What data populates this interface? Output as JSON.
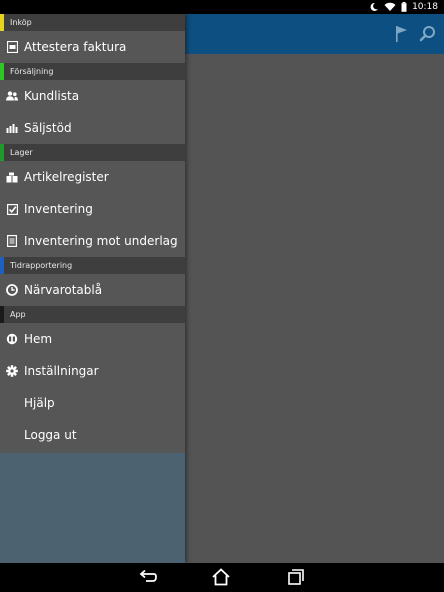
{
  "status": {
    "time": "10:18",
    "icons": [
      "moon-icon",
      "wifi-icon",
      "battery-icon"
    ]
  },
  "toolbar": {
    "icons": [
      "flag-icon",
      "search-icon"
    ]
  },
  "drawer": {
    "sections": [
      {
        "title": "Inköp",
        "accent": "#e7d21d",
        "items": [
          {
            "label": "Attestera faktura",
            "icon": "invoice-icon"
          }
        ]
      },
      {
        "title": "Försäljning",
        "accent": "#2fc626",
        "items": [
          {
            "label": "Kundlista",
            "icon": "people-icon"
          },
          {
            "label": "Säljstöd",
            "icon": "bar-chart-icon"
          }
        ]
      },
      {
        "title": "Lager",
        "accent": "#1f9a2c",
        "items": [
          {
            "label": "Artikelregister",
            "icon": "boxes-icon"
          },
          {
            "label": "Inventering",
            "icon": "checkbox-icon"
          },
          {
            "label": "Inventering mot underlag",
            "icon": "document-icon"
          }
        ]
      },
      {
        "title": "Tidrapportering",
        "accent": "#1e5fc2",
        "items": [
          {
            "label": "Närvarotablå",
            "icon": "clock-icon"
          }
        ]
      },
      {
        "title": "App",
        "accent": "#1a1a1a",
        "items": [
          {
            "label": "Hem",
            "icon": "home-logo-icon"
          },
          {
            "label": "Inställningar",
            "icon": "gear-icon"
          },
          {
            "label": "Hjälp",
            "icon": ""
          },
          {
            "label": "Logga ut",
            "icon": ""
          }
        ]
      }
    ]
  },
  "navbar": {
    "icons": [
      "back-icon",
      "home-icon",
      "recent-apps-icon"
    ]
  },
  "colors": {
    "toolbar": "#0d4f80",
    "drawer": "#565656",
    "section_header": "#3e3e3e"
  }
}
